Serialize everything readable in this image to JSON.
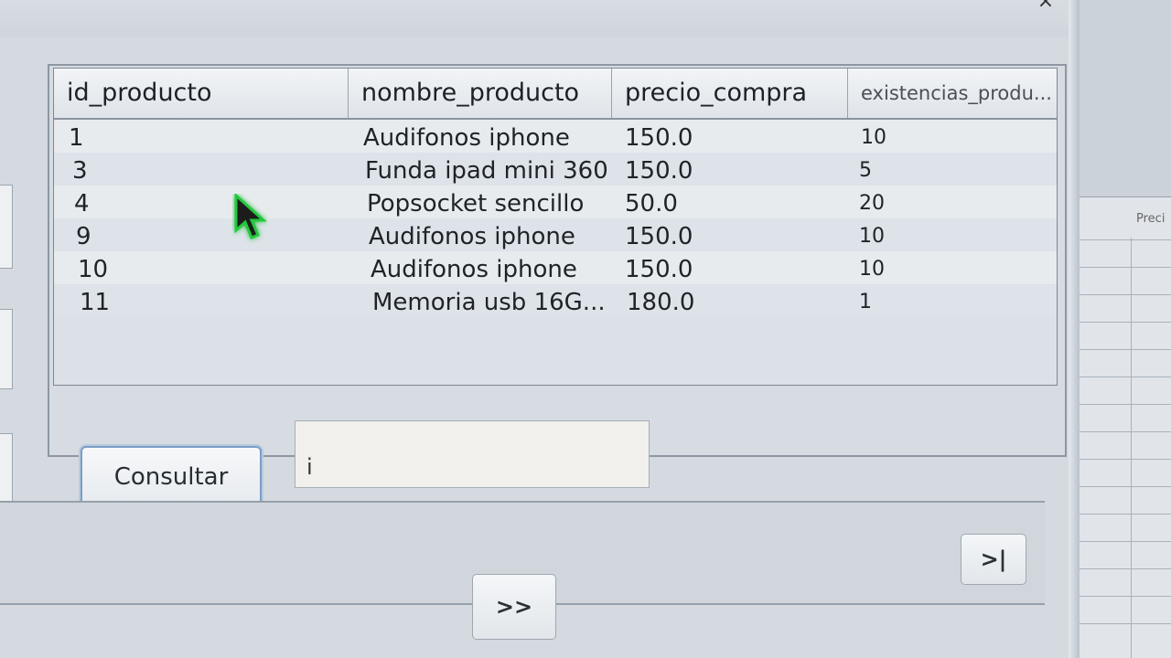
{
  "window": {
    "close_icon": "close-icon"
  },
  "table": {
    "columns": [
      "id_producto",
      "nombre_producto",
      "precio_compra",
      "existencias_produ..."
    ],
    "rows": [
      [
        "1",
        "Audifonos iphone",
        "150.0",
        "10"
      ],
      [
        "3",
        "Funda ipad mini 360",
        "150.0",
        "5"
      ],
      [
        "4",
        "Popsocket sencillo",
        "50.0",
        "20"
      ],
      [
        "9",
        "Audifonos iphone",
        "150.0",
        "10"
      ],
      [
        "10",
        "Audifonos iphone",
        "150.0",
        "10"
      ],
      [
        "11",
        "Memoria usb 16G...",
        "180.0",
        "1"
      ]
    ]
  },
  "form": {
    "consultar_label": "Consultar",
    "search_value": "i"
  },
  "navigation": {
    "next_label": ">>",
    "last_label": ">|"
  },
  "right_window": {
    "header_label": "Preci"
  },
  "colors": {
    "accent_border": "#7a9dc4",
    "cursor": "#1a1a1a",
    "cursor_glow": "#22c83a"
  }
}
